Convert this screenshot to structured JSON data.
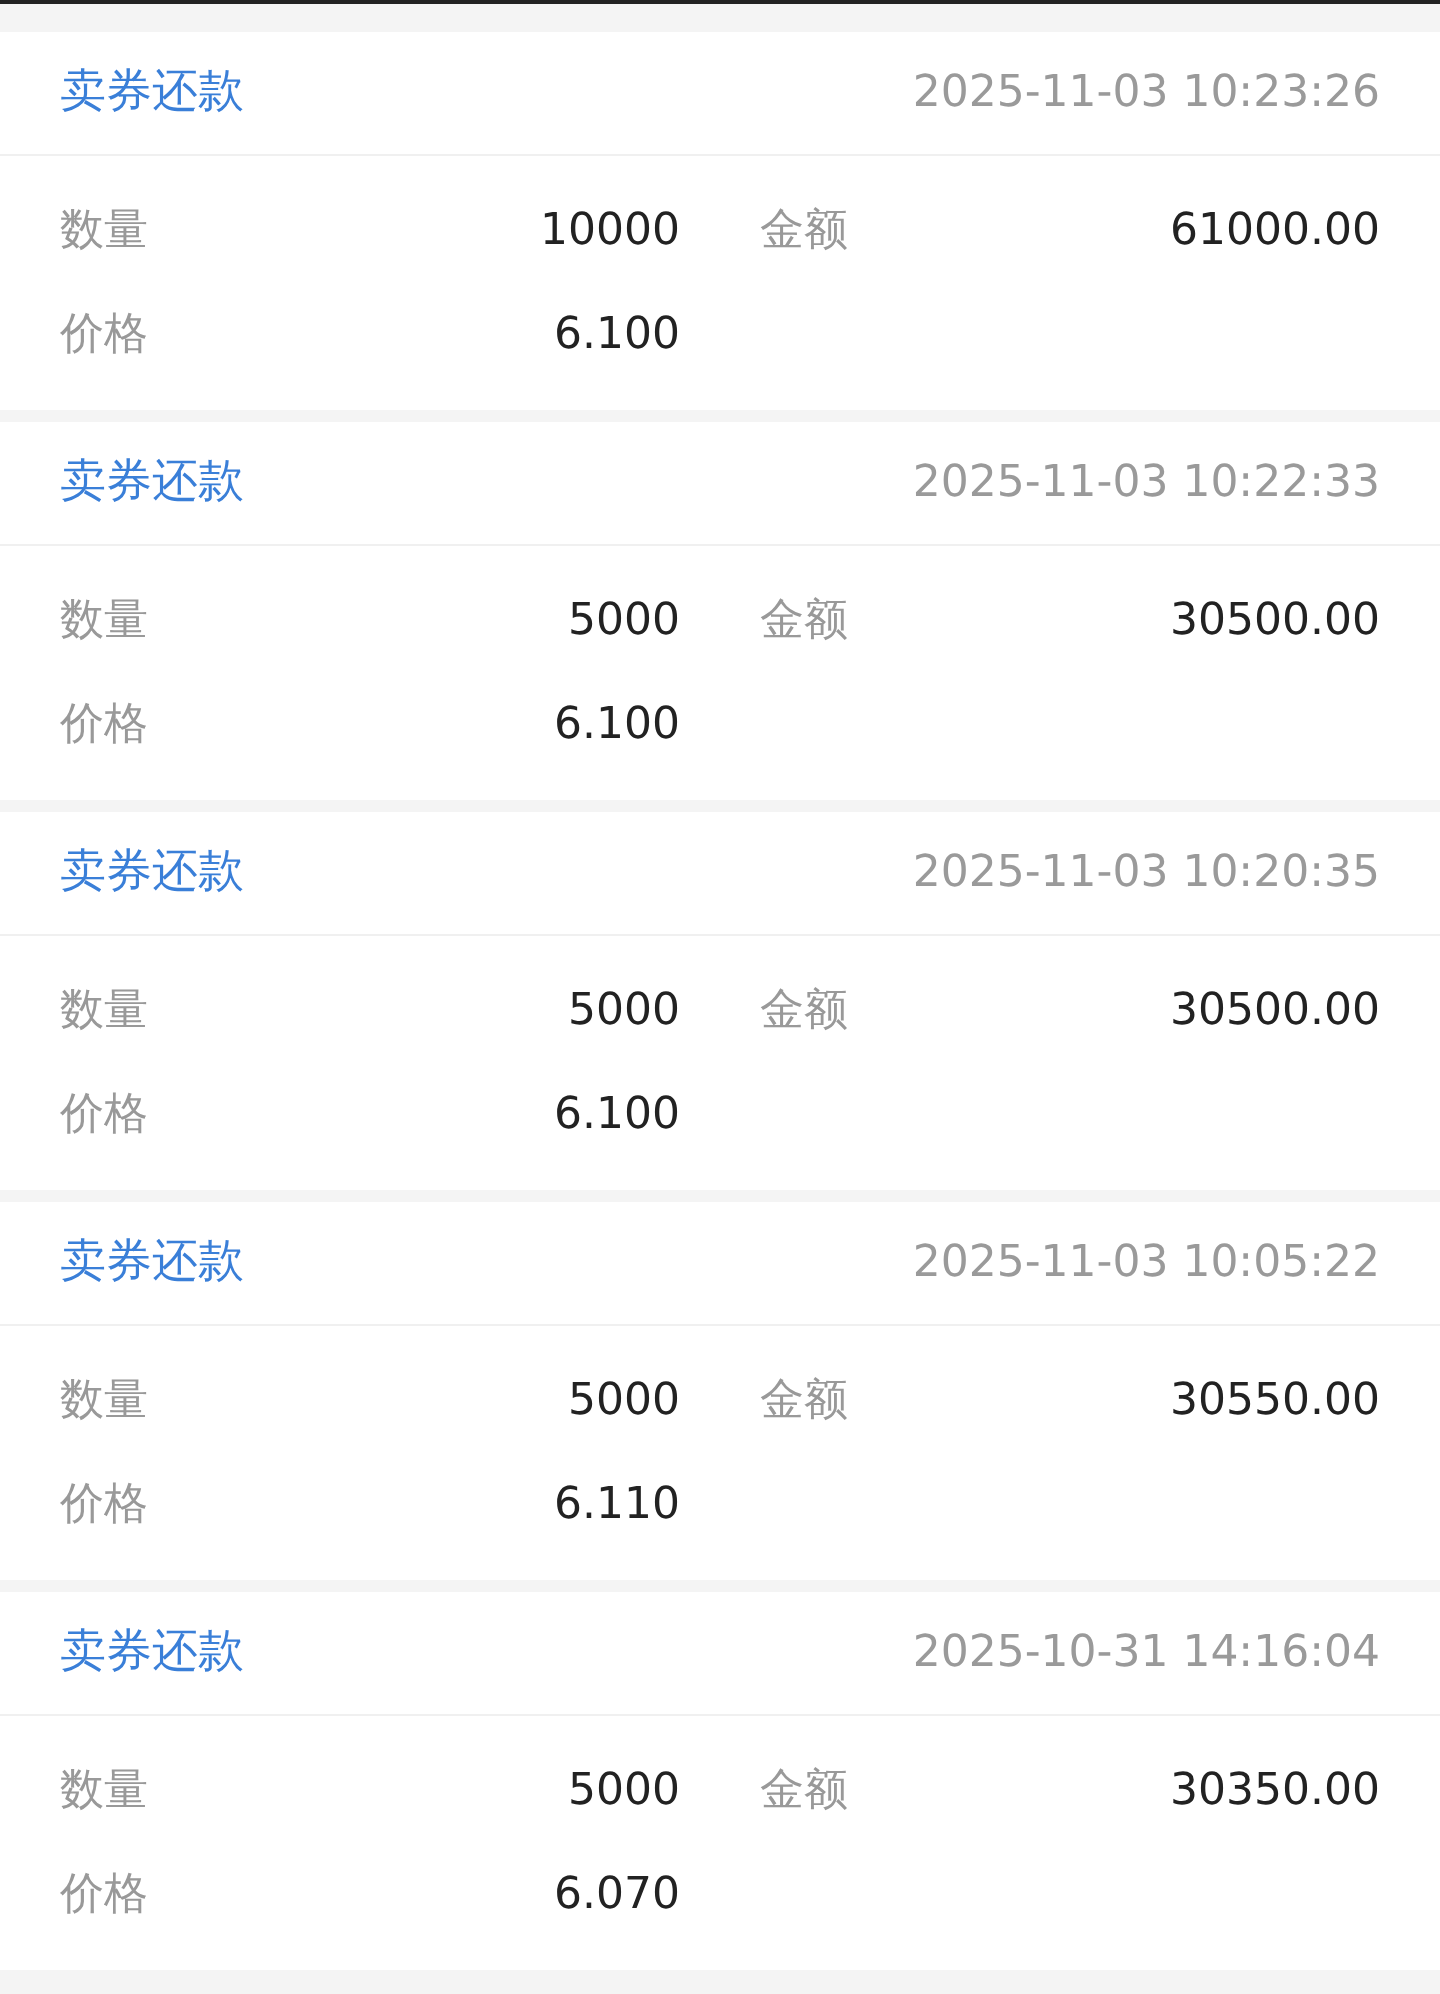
{
  "records": [
    {
      "type": "卖券还款",
      "time": "2025-11-03 10:23:26",
      "quantity_label": "数量",
      "quantity": "10000",
      "amount_label": "金额",
      "amount": "61000.00",
      "price_label": "价格",
      "price": "6.100"
    },
    {
      "type": "卖券还款",
      "time": "2025-11-03 10:22:33",
      "quantity_label": "数量",
      "quantity": "5000",
      "amount_label": "金额",
      "amount": "30500.00",
      "price_label": "价格",
      "price": "6.100"
    },
    {
      "type": "卖券还款",
      "time": "2025-11-03 10:20:35",
      "quantity_label": "数量",
      "quantity": "5000",
      "amount_label": "金额",
      "amount": "30500.00",
      "price_label": "价格",
      "price": "6.100"
    },
    {
      "type": "卖券还款",
      "time": "2025-11-03 10:05:22",
      "quantity_label": "数量",
      "quantity": "5000",
      "amount_label": "金额",
      "amount": "30550.00",
      "price_label": "价格",
      "price": "6.110"
    },
    {
      "type": "卖券还款",
      "time": "2025-10-31 14:16:04",
      "quantity_label": "数量",
      "quantity": "5000",
      "amount_label": "金额",
      "amount": "30350.00",
      "price_label": "价格",
      "price": "6.070"
    }
  ]
}
